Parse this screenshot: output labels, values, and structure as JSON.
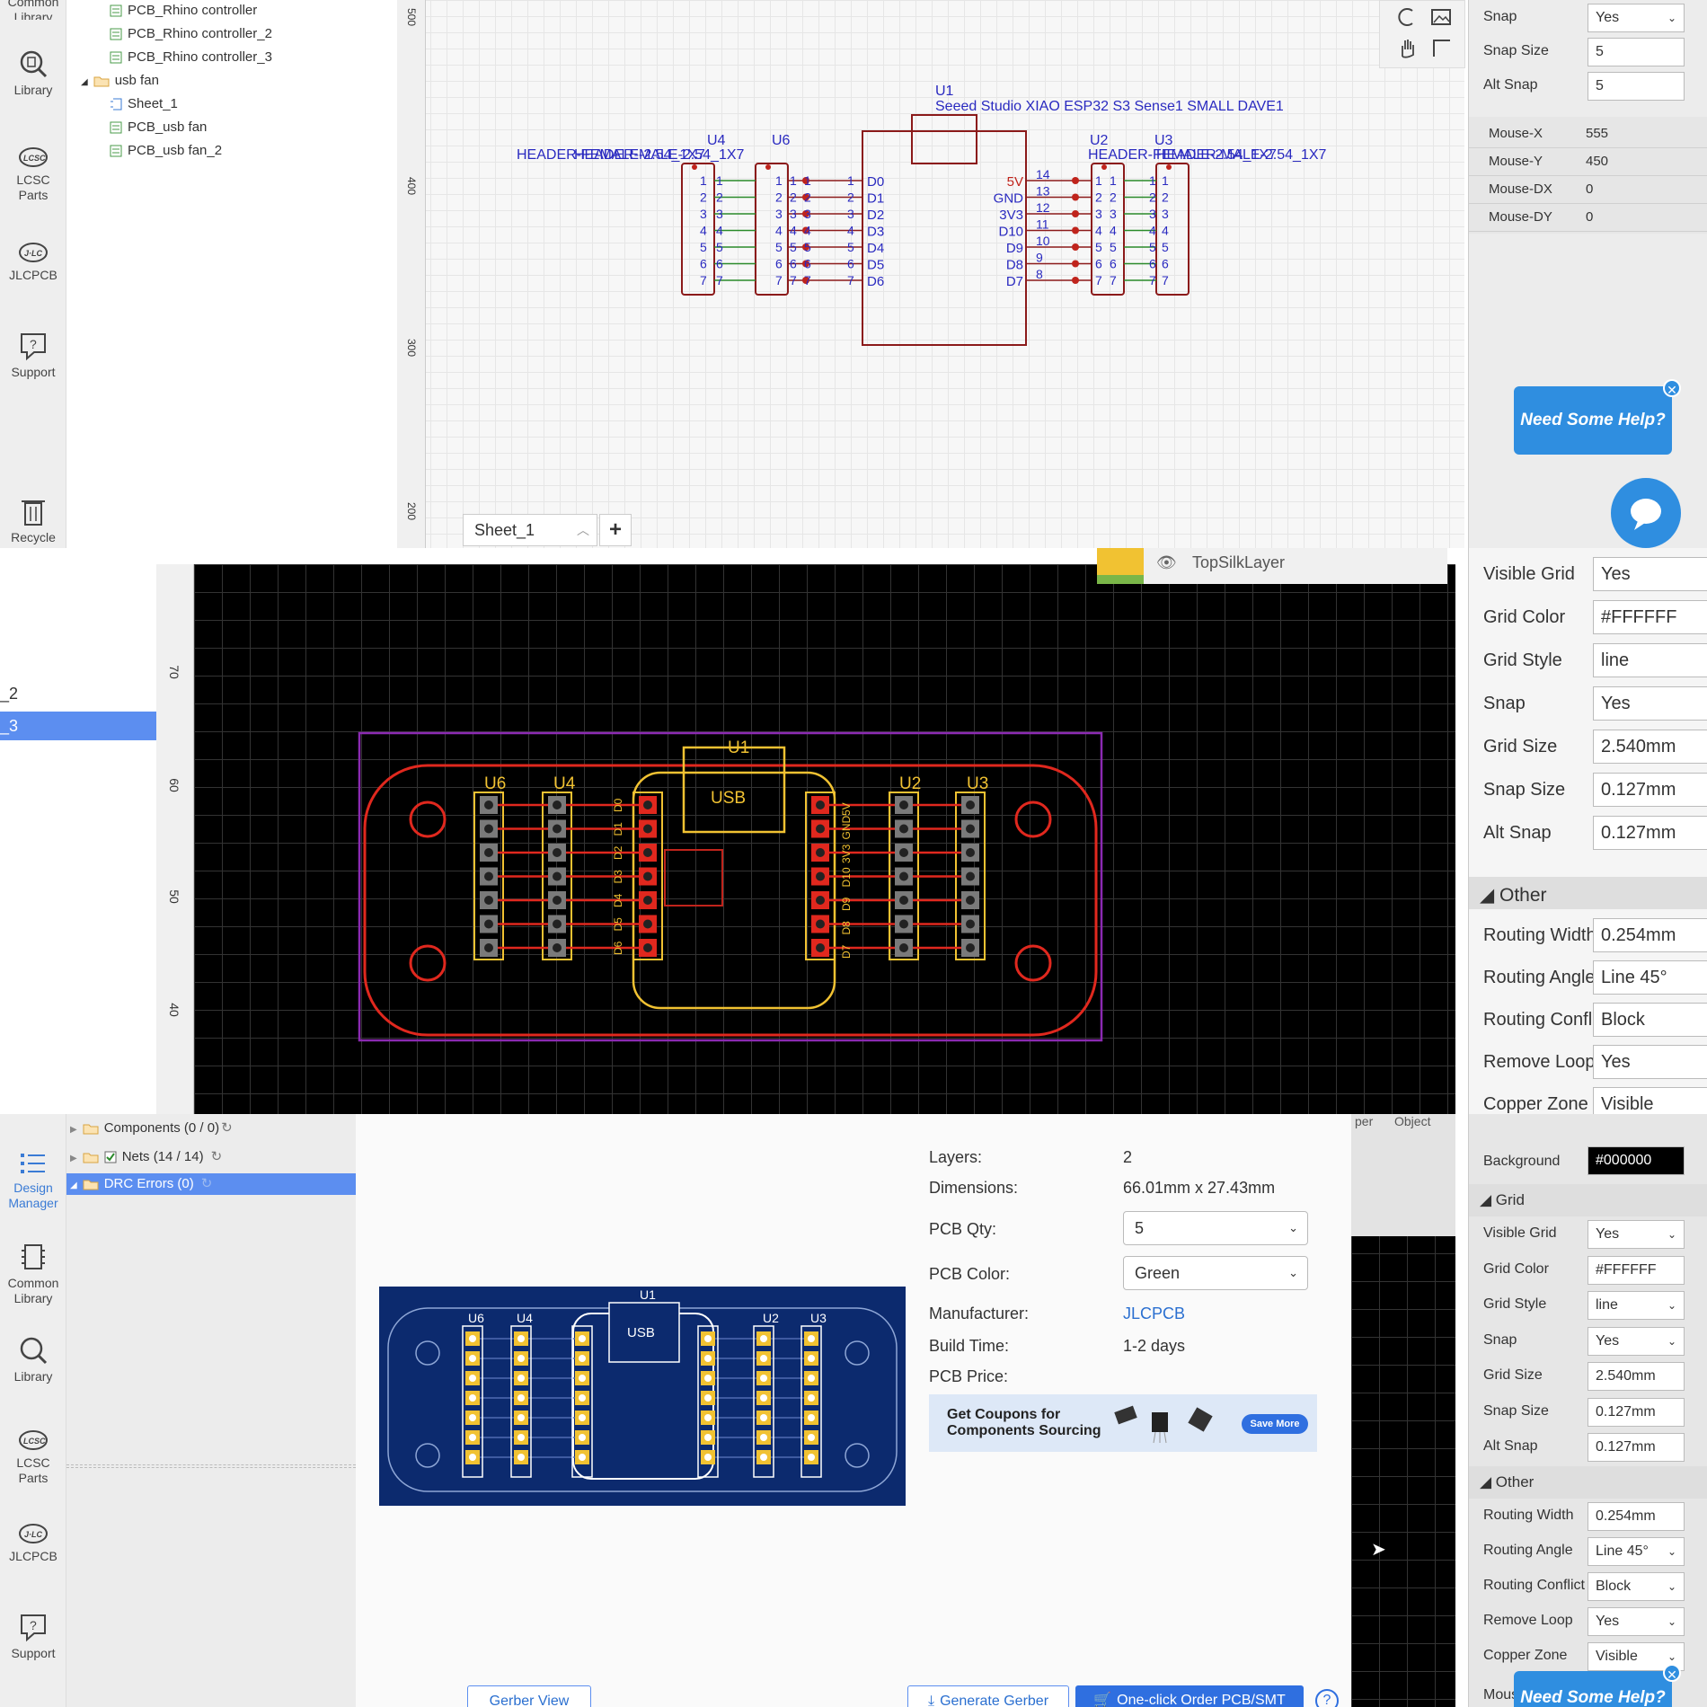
{
  "p1": {
    "leftbar": [
      {
        "label": "Common\nLibrary"
      },
      {
        "label": "Library"
      },
      {
        "label": "LCSC\nParts"
      },
      {
        "label": "JLCPCB"
      },
      {
        "label": "Support"
      },
      {
        "label": "Recycle"
      }
    ],
    "tree": [
      "PCB_Rhino controller",
      "PCB_Rhino controller_2",
      "PCB_Rhino controller_3",
      "usb fan",
      "Sheet_1",
      "PCB_usb fan",
      "PCB_usb fan_2"
    ],
    "ruler": [
      "500",
      "400",
      "300",
      "200"
    ],
    "sheet_tab": "Sheet_1",
    "schematic": {
      "u1_ref": "U1",
      "u1_name": "Seeed Studio XIAO ESP32 S3 Sense1 SMALL DAVE1",
      "u4": "U4",
      "u6": "U6",
      "u2": "U2",
      "u3": "U3",
      "hdr_left": "HEADER-FEMALE-2.54_1X7",
      "hdr_left2": "HEADER-MALE-2.54_1X7",
      "hdr_right": "HEADER-FEMALE-2.54_1X7",
      "hdr_right2": "HEADER-MALE-2.54_1X7",
      "left_pins": [
        "D0",
        "D1",
        "D2",
        "D3",
        "D4",
        "D5",
        "D6"
      ],
      "right_pins": [
        "5V",
        "GND",
        "3V3",
        "D10",
        "D9",
        "D8",
        "D7"
      ],
      "right_nums": [
        "14",
        "13",
        "12",
        "11",
        "10",
        "9",
        "8"
      ],
      "nums": [
        "1",
        "2",
        "3",
        "4",
        "5",
        "6",
        "7"
      ]
    },
    "props": [
      {
        "label": "Snap",
        "value": "Yes",
        "select": true
      },
      {
        "label": "Snap Size",
        "value": "5"
      },
      {
        "label": "Alt Snap",
        "value": "5"
      }
    ],
    "mouse": [
      {
        "label": "Mouse-X",
        "value": "555"
      },
      {
        "label": "Mouse-Y",
        "value": "450"
      },
      {
        "label": "Mouse-DX",
        "value": "0"
      },
      {
        "label": "Mouse-DY",
        "value": "0"
      }
    ],
    "help": "Need Some Help?"
  },
  "p2": {
    "tree_items": [
      "_2",
      "_3"
    ],
    "ruler": [
      "70",
      "60",
      "50",
      "40"
    ],
    "layer": "TopSilkLayer",
    "pcb": {
      "u1": "U1",
      "usb": "USB",
      "u6": "U6",
      "u4": "U4",
      "u2": "U2",
      "u3": "U3",
      "left_pads": [
        "D0",
        "D1",
        "D2",
        "D3",
        "D4",
        "D5",
        "D6"
      ],
      "right_pads": [
        "5V",
        "GND",
        "3V3",
        "D10",
        "D9",
        "D8",
        "D7"
      ]
    },
    "props": [
      {
        "label": "Visible Grid",
        "value": "Yes"
      },
      {
        "label": "Grid Color",
        "value": "#FFFFFF"
      },
      {
        "label": "Grid Style",
        "value": "line"
      },
      {
        "label": "Snap",
        "value": "Yes"
      },
      {
        "label": "Grid Size",
        "value": "2.540mm"
      },
      {
        "label": "Snap Size",
        "value": "0.127mm"
      },
      {
        "label": "Alt Snap",
        "value": "0.127mm"
      }
    ],
    "other_header": "Other",
    "other": [
      {
        "label": "Routing Width",
        "value": "0.254mm"
      },
      {
        "label": "Routing Angle",
        "value": "Line 45°"
      },
      {
        "label": "Routing Conflict",
        "value": "Block"
      },
      {
        "label": "Remove Loop",
        "value": "Yes"
      },
      {
        "label": "Copper Zone",
        "value": "Visible"
      }
    ]
  },
  "p3": {
    "leftbar": [
      {
        "label": "Design\nManager"
      },
      {
        "label": "Common\nLibrary"
      },
      {
        "label": "Library"
      },
      {
        "label": "LCSC\nParts"
      },
      {
        "label": "JLCPCB"
      },
      {
        "label": "Support"
      }
    ],
    "tree": [
      {
        "label": "Components (0 / 0)"
      },
      {
        "label": "Nets (14 / 14)"
      },
      {
        "label": "DRC Errors (0)"
      }
    ],
    "order": {
      "layers_label": "Layers:",
      "layers": "2",
      "dim_label": "Dimensions:",
      "dim": "66.01mm x 27.43mm",
      "qty_label": "PCB Qty:",
      "qty": "5",
      "color_label": "PCB Color:",
      "color": "Green",
      "mfr_label": "Manufacturer:",
      "mfr": "JLCPCB",
      "build_label": "Build Time:",
      "build": "1-2 days",
      "price_label": "PCB Price:",
      "coupon_line1": "Get Coupons for",
      "coupon_line2": "Components Sourcing",
      "coupon_btn": "Save More",
      "gerber_view": "Gerber View",
      "generate": "Generate Gerber",
      "order_btn": "One-click Order PCB/SMT",
      "preview": {
        "u1": "U1",
        "usb": "USB",
        "u6": "U6",
        "u4": "U4",
        "u2": "U2",
        "u3": "U3"
      }
    },
    "tabs_partial": [
      "per",
      "Object"
    ],
    "props_top": [
      {
        "label": "Background",
        "value": "#000000"
      }
    ],
    "grid_header": "Grid",
    "props": [
      {
        "label": "Visible Grid",
        "value": "Yes",
        "select": true
      },
      {
        "label": "Grid Color",
        "value": "#FFFFFF"
      },
      {
        "label": "Grid Style",
        "value": "line",
        "select": true
      },
      {
        "label": "Snap",
        "value": "Yes",
        "select": true
      },
      {
        "label": "Grid Size",
        "value": "2.540mm"
      },
      {
        "label": "Snap Size",
        "value": "0.127mm"
      },
      {
        "label": "Alt Snap",
        "value": "0.127mm"
      }
    ],
    "other_header": "Other",
    "other": [
      {
        "label": "Routing Width",
        "value": "0.254mm"
      },
      {
        "label": "Routing Angle",
        "value": "Line 45°",
        "select": true
      },
      {
        "label": "Routing Conflict",
        "value": "Block",
        "select": true
      },
      {
        "label": "Remove Loop",
        "value": "Yes",
        "select": true
      },
      {
        "label": "Copper Zone",
        "value": "Visible",
        "select": true
      }
    ],
    "mouse_partial": "Mous",
    "help": "Need Some Help?"
  }
}
